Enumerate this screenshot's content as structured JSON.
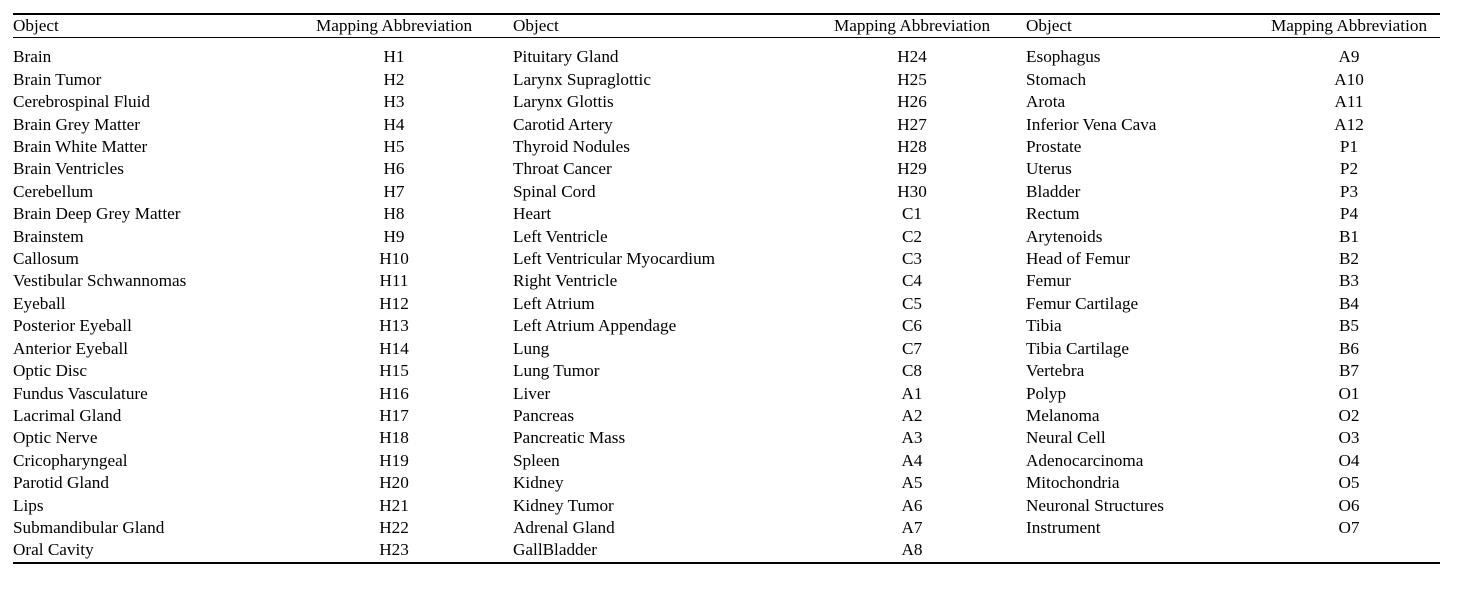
{
  "table": {
    "headers": {
      "object": "Object",
      "abbreviation": "Mapping Abbreviation"
    },
    "columns": [
      {
        "rows": [
          {
            "object": "Brain",
            "abbr": "H1"
          },
          {
            "object": "Brain Tumor",
            "abbr": "H2"
          },
          {
            "object": "Cerebrospinal Fluid",
            "abbr": "H3"
          },
          {
            "object": "Brain Grey Matter",
            "abbr": "H4"
          },
          {
            "object": "Brain White Matter",
            "abbr": "H5"
          },
          {
            "object": "Brain Ventricles",
            "abbr": "H6"
          },
          {
            "object": "Cerebellum",
            "abbr": "H7"
          },
          {
            "object": "Brain Deep Grey Matter",
            "abbr": "H8"
          },
          {
            "object": "Brainstem",
            "abbr": "H9"
          },
          {
            "object": "Callosum",
            "abbr": "H10"
          },
          {
            "object": "Vestibular Schwannomas",
            "abbr": "H11"
          },
          {
            "object": "Eyeball",
            "abbr": "H12"
          },
          {
            "object": "Posterior Eyeball",
            "abbr": "H13"
          },
          {
            "object": "Anterior Eyeball",
            "abbr": "H14"
          },
          {
            "object": "Optic Disc",
            "abbr": "H15"
          },
          {
            "object": "Fundus Vasculature",
            "abbr": "H16"
          },
          {
            "object": "Lacrimal Gland",
            "abbr": "H17"
          },
          {
            "object": "Optic Nerve",
            "abbr": "H18"
          },
          {
            "object": "Cricopharyngeal",
            "abbr": "H19"
          },
          {
            "object": "Parotid Gland",
            "abbr": "H20"
          },
          {
            "object": "Lips",
            "abbr": "H21"
          },
          {
            "object": "Submandibular Gland",
            "abbr": "H22"
          },
          {
            "object": "Oral Cavity",
            "abbr": "H23"
          }
        ]
      },
      {
        "rows": [
          {
            "object": "Pituitary Gland",
            "abbr": "H24"
          },
          {
            "object": "Larynx Supraglottic",
            "abbr": "H25"
          },
          {
            "object": "Larynx Glottis",
            "abbr": "H26"
          },
          {
            "object": "Carotid Artery",
            "abbr": "H27"
          },
          {
            "object": "Thyroid Nodules",
            "abbr": "H28"
          },
          {
            "object": "Throat Cancer",
            "abbr": "H29"
          },
          {
            "object": "Spinal Cord",
            "abbr": "H30"
          },
          {
            "object": "Heart",
            "abbr": "C1"
          },
          {
            "object": "Left Ventricle",
            "abbr": "C2"
          },
          {
            "object": "Left Ventricular Myocardium",
            "abbr": "C3"
          },
          {
            "object": "Right Ventricle",
            "abbr": "C4"
          },
          {
            "object": "Left Atrium",
            "abbr": "C5"
          },
          {
            "object": "Left Atrium Appendage",
            "abbr": "C6"
          },
          {
            "object": "Lung",
            "abbr": "C7"
          },
          {
            "object": "Lung Tumor",
            "abbr": "C8"
          },
          {
            "object": "Liver",
            "abbr": "A1"
          },
          {
            "object": "Pancreas",
            "abbr": "A2"
          },
          {
            "object": "Pancreatic Mass",
            "abbr": "A3"
          },
          {
            "object": "Spleen",
            "abbr": "A4"
          },
          {
            "object": "Kidney",
            "abbr": "A5"
          },
          {
            "object": "Kidney Tumor",
            "abbr": "A6"
          },
          {
            "object": "Adrenal Gland",
            "abbr": "A7"
          },
          {
            "object": "GallBladder",
            "abbr": "A8"
          }
        ]
      },
      {
        "rows": [
          {
            "object": "Esophagus",
            "abbr": "A9"
          },
          {
            "object": "Stomach",
            "abbr": "A10"
          },
          {
            "object": "Arota",
            "abbr": "A11"
          },
          {
            "object": "Inferior Vena Cava",
            "abbr": "A12"
          },
          {
            "object": "Prostate",
            "abbr": "P1"
          },
          {
            "object": "Uterus",
            "abbr": "P2"
          },
          {
            "object": "Bladder",
            "abbr": "P3"
          },
          {
            "object": "Rectum",
            "abbr": "P4"
          },
          {
            "object": "Arytenoids",
            "abbr": "B1"
          },
          {
            "object": "Head of Femur",
            "abbr": "B2"
          },
          {
            "object": "Femur",
            "abbr": "B3"
          },
          {
            "object": "Femur Cartilage",
            "abbr": "B4"
          },
          {
            "object": "Tibia",
            "abbr": "B5"
          },
          {
            "object": "Tibia Cartilage",
            "abbr": "B6"
          },
          {
            "object": "Vertebra",
            "abbr": "B7"
          },
          {
            "object": "Polyp",
            "abbr": "O1"
          },
          {
            "object": "Melanoma",
            "abbr": "O2"
          },
          {
            "object": "Neural Cell",
            "abbr": "O3"
          },
          {
            "object": "Adenocarcinoma",
            "abbr": "O4"
          },
          {
            "object": "Mitochondria",
            "abbr": "O5"
          },
          {
            "object": "Neuronal Structures",
            "abbr": "O6"
          },
          {
            "object": "Instrument",
            "abbr": "O7"
          },
          {
            "object": "",
            "abbr": ""
          }
        ]
      }
    ]
  }
}
